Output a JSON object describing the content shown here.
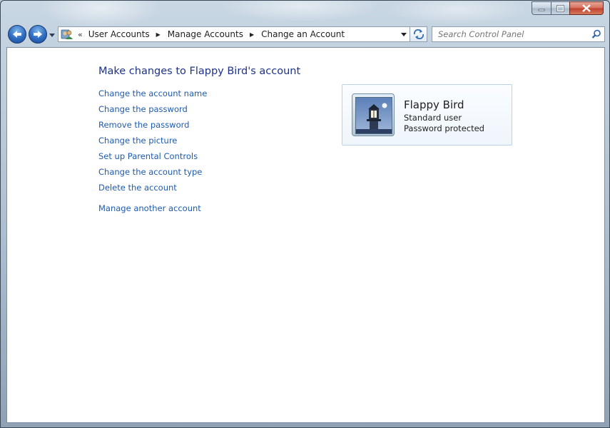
{
  "window": {
    "controls": {
      "minimize": "minimize-icon",
      "maximize": "maximize-icon",
      "close": "close-icon"
    }
  },
  "nav": {
    "back_icon": "back-arrow-icon",
    "forward_icon": "forward-arrow-icon",
    "breadcrumbs": [
      "User Accounts",
      "Manage Accounts",
      "Change an Account"
    ],
    "search_placeholder": "Search Control Panel"
  },
  "main": {
    "title": "Make changes to Flappy Bird's account",
    "links": [
      "Change the account name",
      "Change the password",
      "Remove the password",
      "Change the picture",
      "Set up Parental Controls",
      "Change the account type",
      "Delete the account"
    ],
    "manage_other": "Manage another account"
  },
  "account": {
    "name": "Flappy Bird",
    "type": "Standard user",
    "password_status": "Password protected",
    "picture": "lighthouse-picture"
  },
  "colors": {
    "link": "#1e5bb0",
    "title": "#1e3287"
  }
}
